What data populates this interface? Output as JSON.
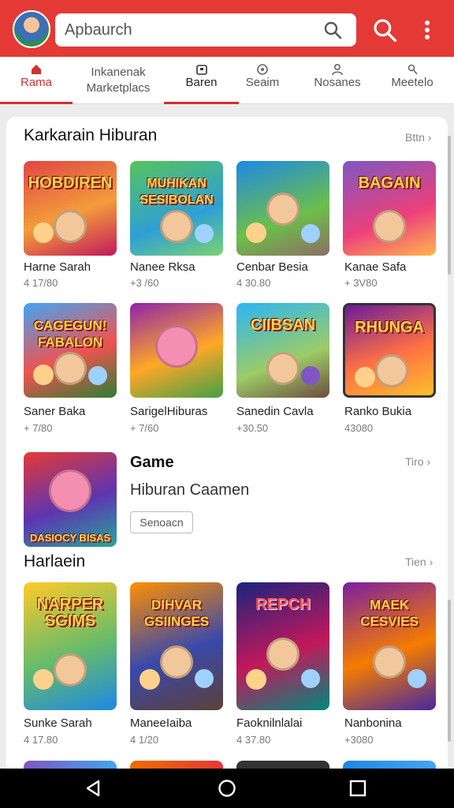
{
  "header": {
    "search_text": "Apbaurch",
    "colors": {
      "brand": "#e53935",
      "accent": "#d32f2f"
    },
    "icons": [
      "avatar",
      "search-icon",
      "more-vert-icon"
    ]
  },
  "tabs": [
    {
      "label": "Rama",
      "icon": "home-icon",
      "active": true
    },
    {
      "label": "Inkanenak Marketplacs",
      "icon": "",
      "active": false
    },
    {
      "label": "Baren",
      "icon": "bag-icon",
      "active": false
    },
    {
      "label": "Seaim",
      "icon": "badge-icon",
      "active": false
    },
    {
      "label": "Nosanes",
      "icon": "person-icon",
      "active": false
    },
    {
      "label": "Meetelo",
      "icon": "user-search-icon",
      "active": false
    }
  ],
  "section1": {
    "title": "Karkarain Hiburan",
    "see_all": "Bttn",
    "items": [
      {
        "art_text": "HOBDIREN",
        "name": "Harne Sarah",
        "count": "4 17/80"
      },
      {
        "art_text": "MUHIKAN SESIBOLAN",
        "name": "Nanee Rksa",
        "count": "+3 /60"
      },
      {
        "art_text": "",
        "name": "Cenbar Besia",
        "count": "4 30.80"
      },
      {
        "art_text": "BAGAIN",
        "name": "Kanae Safa",
        "count": "+ 3V80"
      },
      {
        "art_text": "CAGEGUN! FABALON",
        "name": "Saner Baka",
        "count": "+ 7/80"
      },
      {
        "art_text": "",
        "name": "SarigelHiburas",
        "count": "+ 7/60"
      },
      {
        "art_text": "CIIBSAN",
        "name": "Sanedin Cavla",
        "count": "+30.50"
      },
      {
        "art_text": "RHUNGA",
        "name": "Ranko Bukia",
        "count": "43080"
      }
    ]
  },
  "featured": {
    "art_text": "DASIOCY BISAS",
    "title": "Game",
    "subtitle": "Hiburan Caamen",
    "button": "Senoacn",
    "see_all": "Tiro"
  },
  "section2": {
    "title": "Harlaein",
    "see_all": "Tien",
    "items": [
      {
        "art_text": "NARPER SGIMS",
        "name": "Sunke Sarah",
        "count": "4 17.80"
      },
      {
        "art_text": "DIHVAR GSIINGES",
        "name": "ManeeIaiba",
        "count": "4 1/20"
      },
      {
        "art_text": "REPCH",
        "name": "Faoknilnlalai",
        "count": "4 37.80"
      },
      {
        "art_text": "MAEK CESVIES",
        "name": "Nanbonina",
        "count": "+3080"
      }
    ]
  },
  "system_nav": {
    "icons": [
      "back-icon",
      "home-circle-icon",
      "recents-icon"
    ]
  }
}
